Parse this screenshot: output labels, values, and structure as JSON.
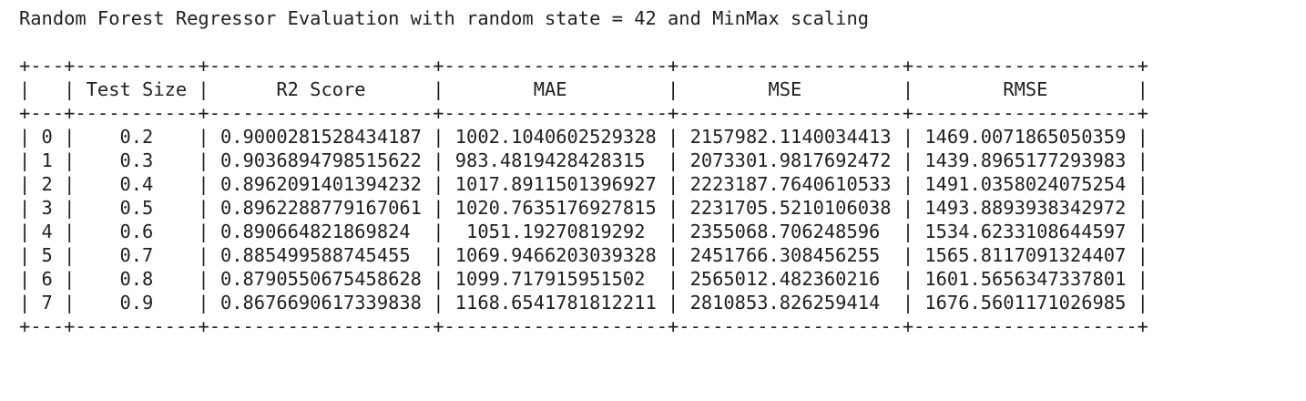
{
  "title": "Random Forest Regressor Evaluation with random state = 42 and MinMax scaling",
  "table": {
    "columns": [
      "",
      "Test Size",
      "R2 Score",
      "MAE",
      "MSE",
      "RMSE"
    ],
    "rows": [
      [
        "0",
        "0.2",
        "0.9000281528434187",
        "1002.1040602529328",
        "2157982.1140034413",
        "1469.0071865050359"
      ],
      [
        "1",
        "0.3",
        "0.9036894798515622",
        "983.4819428428315",
        "2073301.9817692472",
        "1439.8965177293983"
      ],
      [
        "2",
        "0.4",
        "0.8962091401394232",
        "1017.8911501396927",
        "2223187.7640610533",
        "1491.0358024075254"
      ],
      [
        "3",
        "0.5",
        "0.8962288779167061",
        "1020.7635176927815",
        "2231705.5210106038",
        "1493.8893938342972"
      ],
      [
        "4",
        "0.6",
        "0.890664821869824",
        "1051.19270819292",
        "2355068.706248596",
        "1534.6233108644597"
      ],
      [
        "5",
        "0.7",
        "0.885499588745455",
        "1069.9466203039328",
        "2451766.308456255",
        "1565.8117091324407"
      ],
      [
        "6",
        "0.8",
        "0.8790550675458628",
        "1099.717915951502",
        "2565012.482360216",
        "1601.5656347337801"
      ],
      [
        "7",
        "0.9",
        "0.8676690617339838",
        "1168.6541781812211",
        "2810853.826259414",
        "1676.5601171026985"
      ]
    ]
  }
}
